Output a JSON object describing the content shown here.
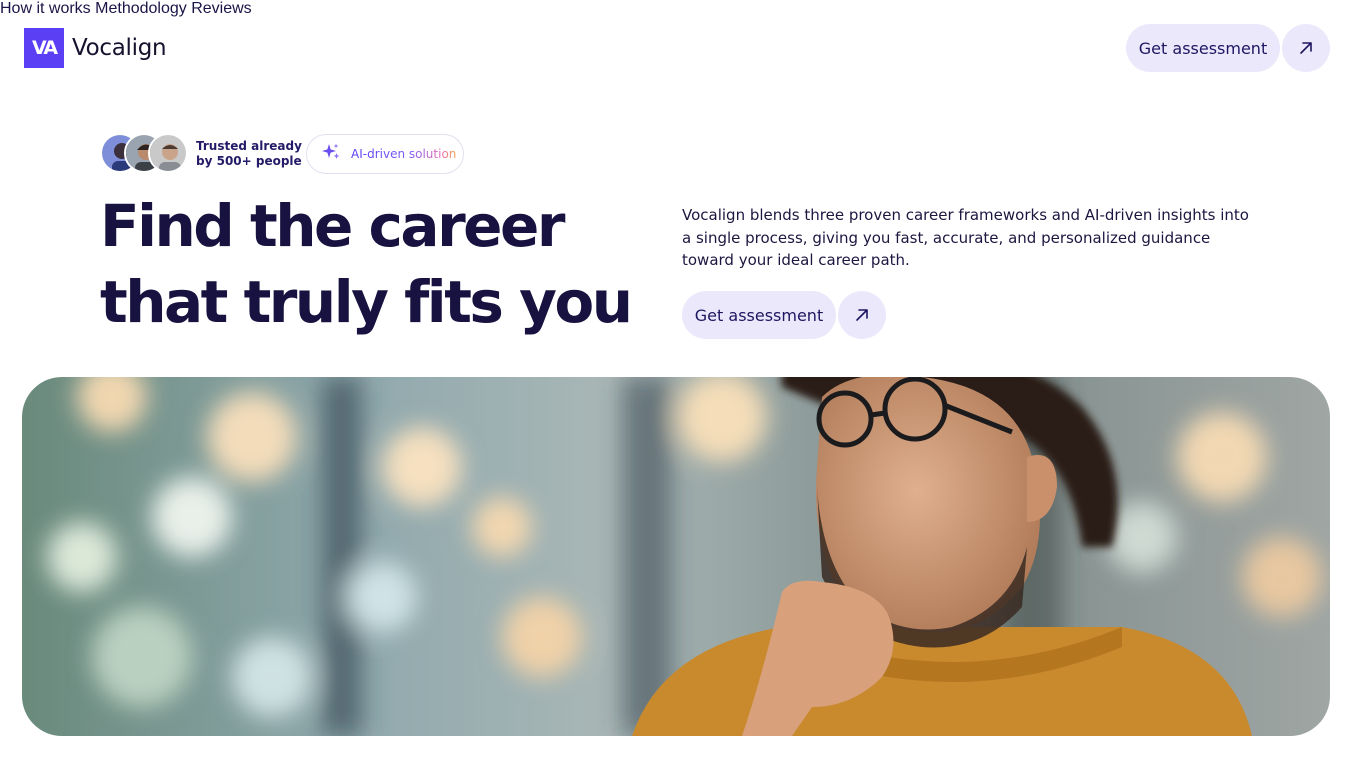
{
  "brand": {
    "logo_mark": "VA",
    "name": "Vocalign",
    "accent": "#5b3ff5"
  },
  "nav": {
    "items": [
      {
        "label": "How it works"
      },
      {
        "label": "Methodology"
      },
      {
        "label": "Reviews"
      }
    ]
  },
  "header_cta": {
    "label": "Get assessment",
    "icon": "arrow-up-right-icon"
  },
  "hero": {
    "trust_line1": "Trusted already",
    "trust_line2": "by 500+ people",
    "ai_badge": {
      "label": "AI-driven solution",
      "icon": "sparkle-icon"
    },
    "headline_line1": "Find the career",
    "headline_line2": "that truly fits you",
    "description": "Vocalign blends three proven career frameworks and AI-driven insights into a single process, giving you fast, accurate, and personalized guidance toward your ideal career path.",
    "cta": {
      "label": "Get assessment",
      "icon": "arrow-up-right-icon"
    }
  },
  "colors": {
    "cta_bg": "#ebe8fc",
    "text_dark": "#17123f",
    "nav_text": "#271a6e"
  }
}
